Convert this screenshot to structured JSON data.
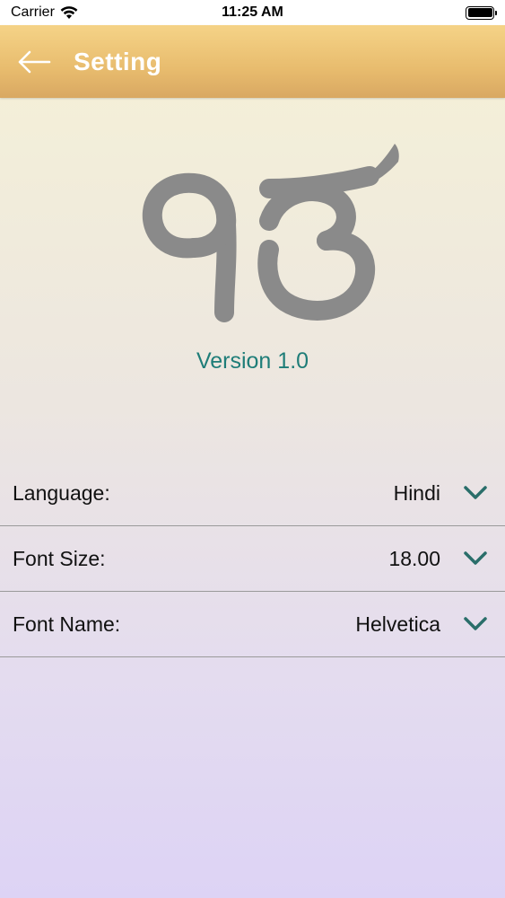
{
  "status_bar": {
    "carrier": "Carrier",
    "time": "11:25 AM",
    "icons": [
      "wifi-icon",
      "battery-icon"
    ]
  },
  "nav": {
    "title": "Setting",
    "back_icon": "arrow-left-icon",
    "title_color": "#ffffff"
  },
  "logo": {
    "icon": "ik-onkar-icon",
    "color": "#8a8a8a"
  },
  "version": {
    "text": "Version 1.0",
    "color": "#1e7d78"
  },
  "settings": [
    {
      "label": "Language:",
      "value": "Hindi"
    },
    {
      "label": "Font Size:",
      "value": "18.00"
    },
    {
      "label": "Font Name:",
      "value": "Helvetica"
    }
  ],
  "colors": {
    "chevron": "#2a6e6a",
    "divider": "#9a9a9a"
  }
}
